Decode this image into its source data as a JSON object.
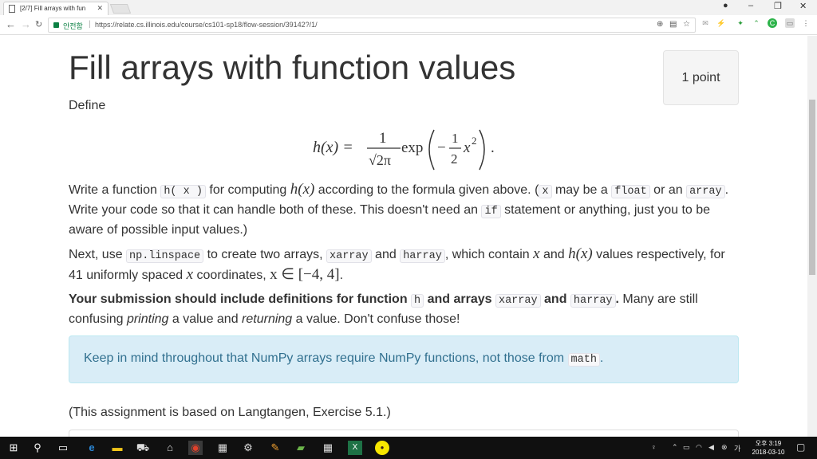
{
  "browser": {
    "tab_title": "[2/7] Fill arrays with fun",
    "secure_label": "안전함",
    "url": "https://relate.cs.illinois.edu/course/cs101-sp18/flow-session/39142?/1/"
  },
  "page": {
    "title": "Fill arrays with function values",
    "points": "1 point",
    "define": "Define",
    "formula": {
      "lhs": "h(x) =",
      "num": "1",
      "den": "√2π",
      "exp": "exp",
      "inner_num": "1",
      "inner_den": "2",
      "inner_var": "x",
      "inner_pow": "2",
      "minus": "−",
      "end": "."
    },
    "p1": {
      "t1": "Write a function ",
      "c1": "h( x )",
      "t2": " for computing ",
      "m1": "h(x)",
      "t3": " according to the formula given above. (",
      "c2": "x",
      "t4": " may be a ",
      "c3": "float",
      "t5": " or an ",
      "c4": "array",
      "t6": ". Write your code so that it can handle both of these. This doesn't need an ",
      "c5": "if",
      "t7": " statement or anything, just you to be aware of possible input values.)"
    },
    "p2": {
      "t1": "Next, use ",
      "c1": "np.linspace",
      "t2": " to create two arrays, ",
      "c2": "xarray",
      "t3": " and ",
      "c3": "harray",
      "t4": ", which contain ",
      "m1": "x",
      "t5": " and ",
      "m2": "h(x)",
      "t6": " values respectively, for 41 uniformly spaced ",
      "m3": "x",
      "t7": " coordinates, ",
      "m4": "x ∈ [−4, 4]",
      "t8": "."
    },
    "p3": {
      "b1": "Your submission should include definitions for function ",
      "c1": "h",
      "b2": " and arrays ",
      "c2": "xarray",
      "b3": " and ",
      "c3": "harray",
      "b4": ".",
      "t1": " Many are still confusing ",
      "i1": "printing",
      "t2": " a value and ",
      "i2": "returning",
      "t3": " a value. Don't confuse those!"
    },
    "alert": {
      "t1": "Keep in mind throughout that NumPy arrays require NumPy functions, not those from ",
      "c1": "math",
      "t2": "."
    },
    "note": "(This assignment is based on Langtangen, Exercise 5.1.)"
  },
  "taskbar": {
    "time": "오후 3:19",
    "date": "2018-03-10"
  },
  "colors": {
    "alert_bg": "#d9edf7",
    "alert_text": "#31708f",
    "secure_green": "#0b8043",
    "taskbar": "#101010"
  }
}
